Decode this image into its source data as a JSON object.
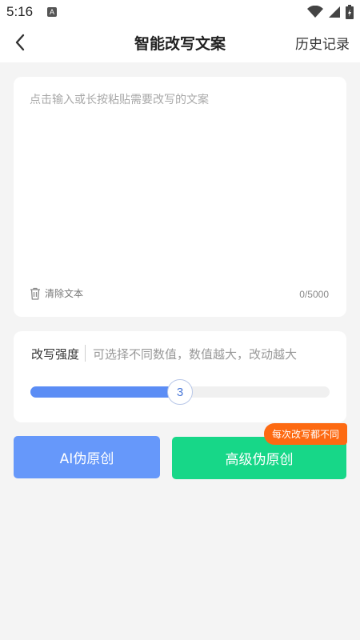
{
  "status_bar": {
    "time": "5:16",
    "notification_glyph": "A",
    "icons": [
      "wifi-icon",
      "signal-icon",
      "battery-icon"
    ]
  },
  "header": {
    "title": "智能改写文案",
    "history_label": "历史记录"
  },
  "input_card": {
    "value": "",
    "placeholder": "点击输入或长按粘贴需要改写的文案",
    "clear_label": "清除文本",
    "char_count": "0/5000"
  },
  "strength": {
    "label": "改写强度",
    "hint": "可选择不同数值，数值越大，改动越大",
    "value": "3",
    "fill_fraction": 0.5
  },
  "actions": {
    "ai_label": "AI伪原创",
    "advanced_label": "高级伪原创",
    "badge": "每次改写都不同"
  },
  "colors": {
    "accent_blue": "#6698fa",
    "accent_green": "#17d788",
    "badge_orange": "#fd6a12",
    "background": "#f4f4f4"
  }
}
